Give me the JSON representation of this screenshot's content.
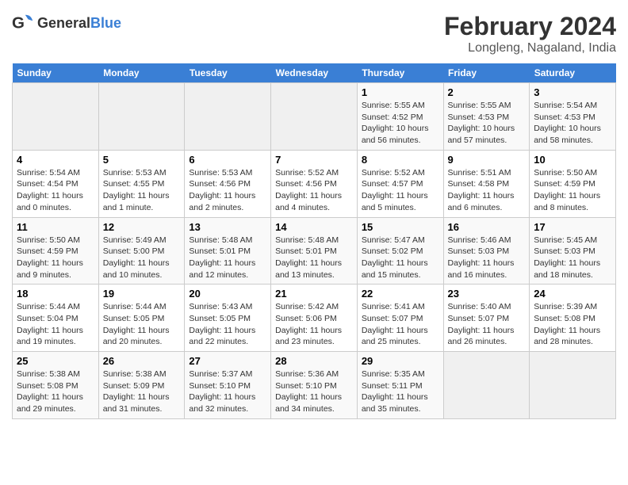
{
  "header": {
    "logo_general": "General",
    "logo_blue": "Blue",
    "title": "February 2024",
    "subtitle": "Longleng, Nagaland, India"
  },
  "days_of_week": [
    "Sunday",
    "Monday",
    "Tuesday",
    "Wednesday",
    "Thursday",
    "Friday",
    "Saturday"
  ],
  "weeks": [
    [
      {
        "day": "",
        "info": ""
      },
      {
        "day": "",
        "info": ""
      },
      {
        "day": "",
        "info": ""
      },
      {
        "day": "",
        "info": ""
      },
      {
        "day": "1",
        "info": "Sunrise: 5:55 AM\nSunset: 4:52 PM\nDaylight: 10 hours\nand 56 minutes."
      },
      {
        "day": "2",
        "info": "Sunrise: 5:55 AM\nSunset: 4:53 PM\nDaylight: 10 hours\nand 57 minutes."
      },
      {
        "day": "3",
        "info": "Sunrise: 5:54 AM\nSunset: 4:53 PM\nDaylight: 10 hours\nand 58 minutes."
      }
    ],
    [
      {
        "day": "4",
        "info": "Sunrise: 5:54 AM\nSunset: 4:54 PM\nDaylight: 11 hours\nand 0 minutes."
      },
      {
        "day": "5",
        "info": "Sunrise: 5:53 AM\nSunset: 4:55 PM\nDaylight: 11 hours\nand 1 minute."
      },
      {
        "day": "6",
        "info": "Sunrise: 5:53 AM\nSunset: 4:56 PM\nDaylight: 11 hours\nand 2 minutes."
      },
      {
        "day": "7",
        "info": "Sunrise: 5:52 AM\nSunset: 4:56 PM\nDaylight: 11 hours\nand 4 minutes."
      },
      {
        "day": "8",
        "info": "Sunrise: 5:52 AM\nSunset: 4:57 PM\nDaylight: 11 hours\nand 5 minutes."
      },
      {
        "day": "9",
        "info": "Sunrise: 5:51 AM\nSunset: 4:58 PM\nDaylight: 11 hours\nand 6 minutes."
      },
      {
        "day": "10",
        "info": "Sunrise: 5:50 AM\nSunset: 4:59 PM\nDaylight: 11 hours\nand 8 minutes."
      }
    ],
    [
      {
        "day": "11",
        "info": "Sunrise: 5:50 AM\nSunset: 4:59 PM\nDaylight: 11 hours\nand 9 minutes."
      },
      {
        "day": "12",
        "info": "Sunrise: 5:49 AM\nSunset: 5:00 PM\nDaylight: 11 hours\nand 10 minutes."
      },
      {
        "day": "13",
        "info": "Sunrise: 5:48 AM\nSunset: 5:01 PM\nDaylight: 11 hours\nand 12 minutes."
      },
      {
        "day": "14",
        "info": "Sunrise: 5:48 AM\nSunset: 5:01 PM\nDaylight: 11 hours\nand 13 minutes."
      },
      {
        "day": "15",
        "info": "Sunrise: 5:47 AM\nSunset: 5:02 PM\nDaylight: 11 hours\nand 15 minutes."
      },
      {
        "day": "16",
        "info": "Sunrise: 5:46 AM\nSunset: 5:03 PM\nDaylight: 11 hours\nand 16 minutes."
      },
      {
        "day": "17",
        "info": "Sunrise: 5:45 AM\nSunset: 5:03 PM\nDaylight: 11 hours\nand 18 minutes."
      }
    ],
    [
      {
        "day": "18",
        "info": "Sunrise: 5:44 AM\nSunset: 5:04 PM\nDaylight: 11 hours\nand 19 minutes."
      },
      {
        "day": "19",
        "info": "Sunrise: 5:44 AM\nSunset: 5:05 PM\nDaylight: 11 hours\nand 20 minutes."
      },
      {
        "day": "20",
        "info": "Sunrise: 5:43 AM\nSunset: 5:05 PM\nDaylight: 11 hours\nand 22 minutes."
      },
      {
        "day": "21",
        "info": "Sunrise: 5:42 AM\nSunset: 5:06 PM\nDaylight: 11 hours\nand 23 minutes."
      },
      {
        "day": "22",
        "info": "Sunrise: 5:41 AM\nSunset: 5:07 PM\nDaylight: 11 hours\nand 25 minutes."
      },
      {
        "day": "23",
        "info": "Sunrise: 5:40 AM\nSunset: 5:07 PM\nDaylight: 11 hours\nand 26 minutes."
      },
      {
        "day": "24",
        "info": "Sunrise: 5:39 AM\nSunset: 5:08 PM\nDaylight: 11 hours\nand 28 minutes."
      }
    ],
    [
      {
        "day": "25",
        "info": "Sunrise: 5:38 AM\nSunset: 5:08 PM\nDaylight: 11 hours\nand 29 minutes."
      },
      {
        "day": "26",
        "info": "Sunrise: 5:38 AM\nSunset: 5:09 PM\nDaylight: 11 hours\nand 31 minutes."
      },
      {
        "day": "27",
        "info": "Sunrise: 5:37 AM\nSunset: 5:10 PM\nDaylight: 11 hours\nand 32 minutes."
      },
      {
        "day": "28",
        "info": "Sunrise: 5:36 AM\nSunset: 5:10 PM\nDaylight: 11 hours\nand 34 minutes."
      },
      {
        "day": "29",
        "info": "Sunrise: 5:35 AM\nSunset: 5:11 PM\nDaylight: 11 hours\nand 35 minutes."
      },
      {
        "day": "",
        "info": ""
      },
      {
        "day": "",
        "info": ""
      }
    ]
  ]
}
